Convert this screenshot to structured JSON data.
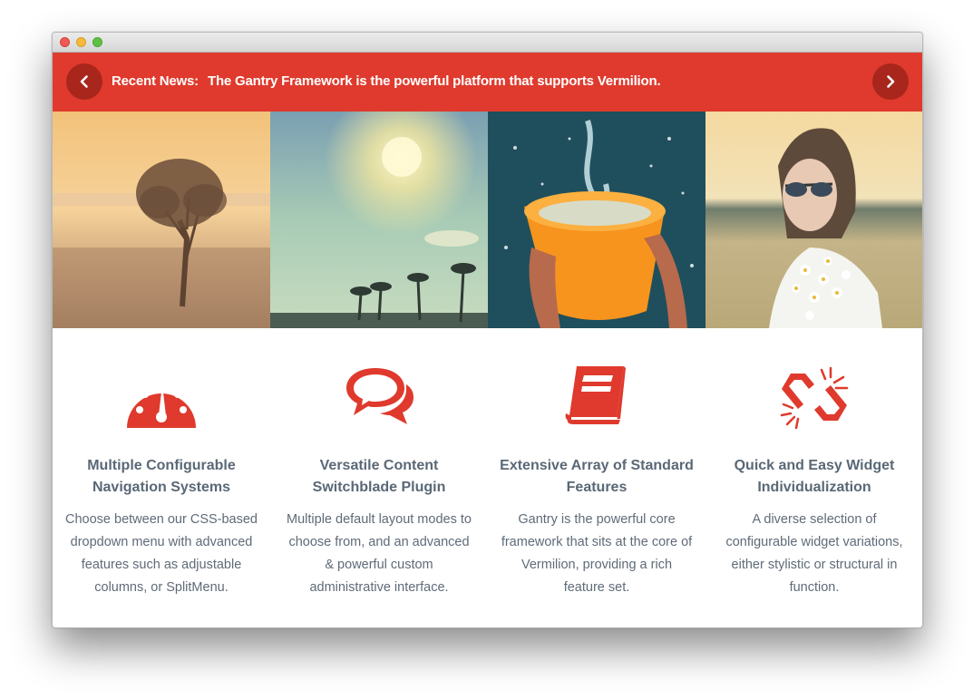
{
  "news": {
    "label": "Recent News:",
    "headline": "The Gantry Framework is the powerful platform that supports Vermilion."
  },
  "gallery": [
    "tree-in-misty-field",
    "sun-over-palm-trees",
    "water-splashing-from-orange-bucket",
    "woman-with-sunglasses-and-daisies"
  ],
  "features": [
    {
      "icon": "speedometer-icon",
      "title": "Multiple Configurable Navigation Systems",
      "text": "Choose between our CSS-based dropdown menu with advanced features such as adjustable columns, or SplitMenu."
    },
    {
      "icon": "chat-bubbles-icon",
      "title": "Versatile Content Switchblade Plugin",
      "text": "Multiple default layout modes to choose from, and an advanced & powerful custom administrative interface."
    },
    {
      "icon": "book-icon",
      "title": "Extensive Array of Standard Features",
      "text": "Gantry is the powerful core framework that sits at the core of Vermilion, providing a rich feature set."
    },
    {
      "icon": "broken-link-icon",
      "title": "Quick and Easy Widget Individualization",
      "text": "A diverse selection of configurable widget variations, either stylistic or structural in function."
    }
  ],
  "colors": {
    "accent": "#df3a2d",
    "accent_dark": "#a9261c",
    "heading": "#5a6876",
    "body_text": "#5f6b78"
  }
}
